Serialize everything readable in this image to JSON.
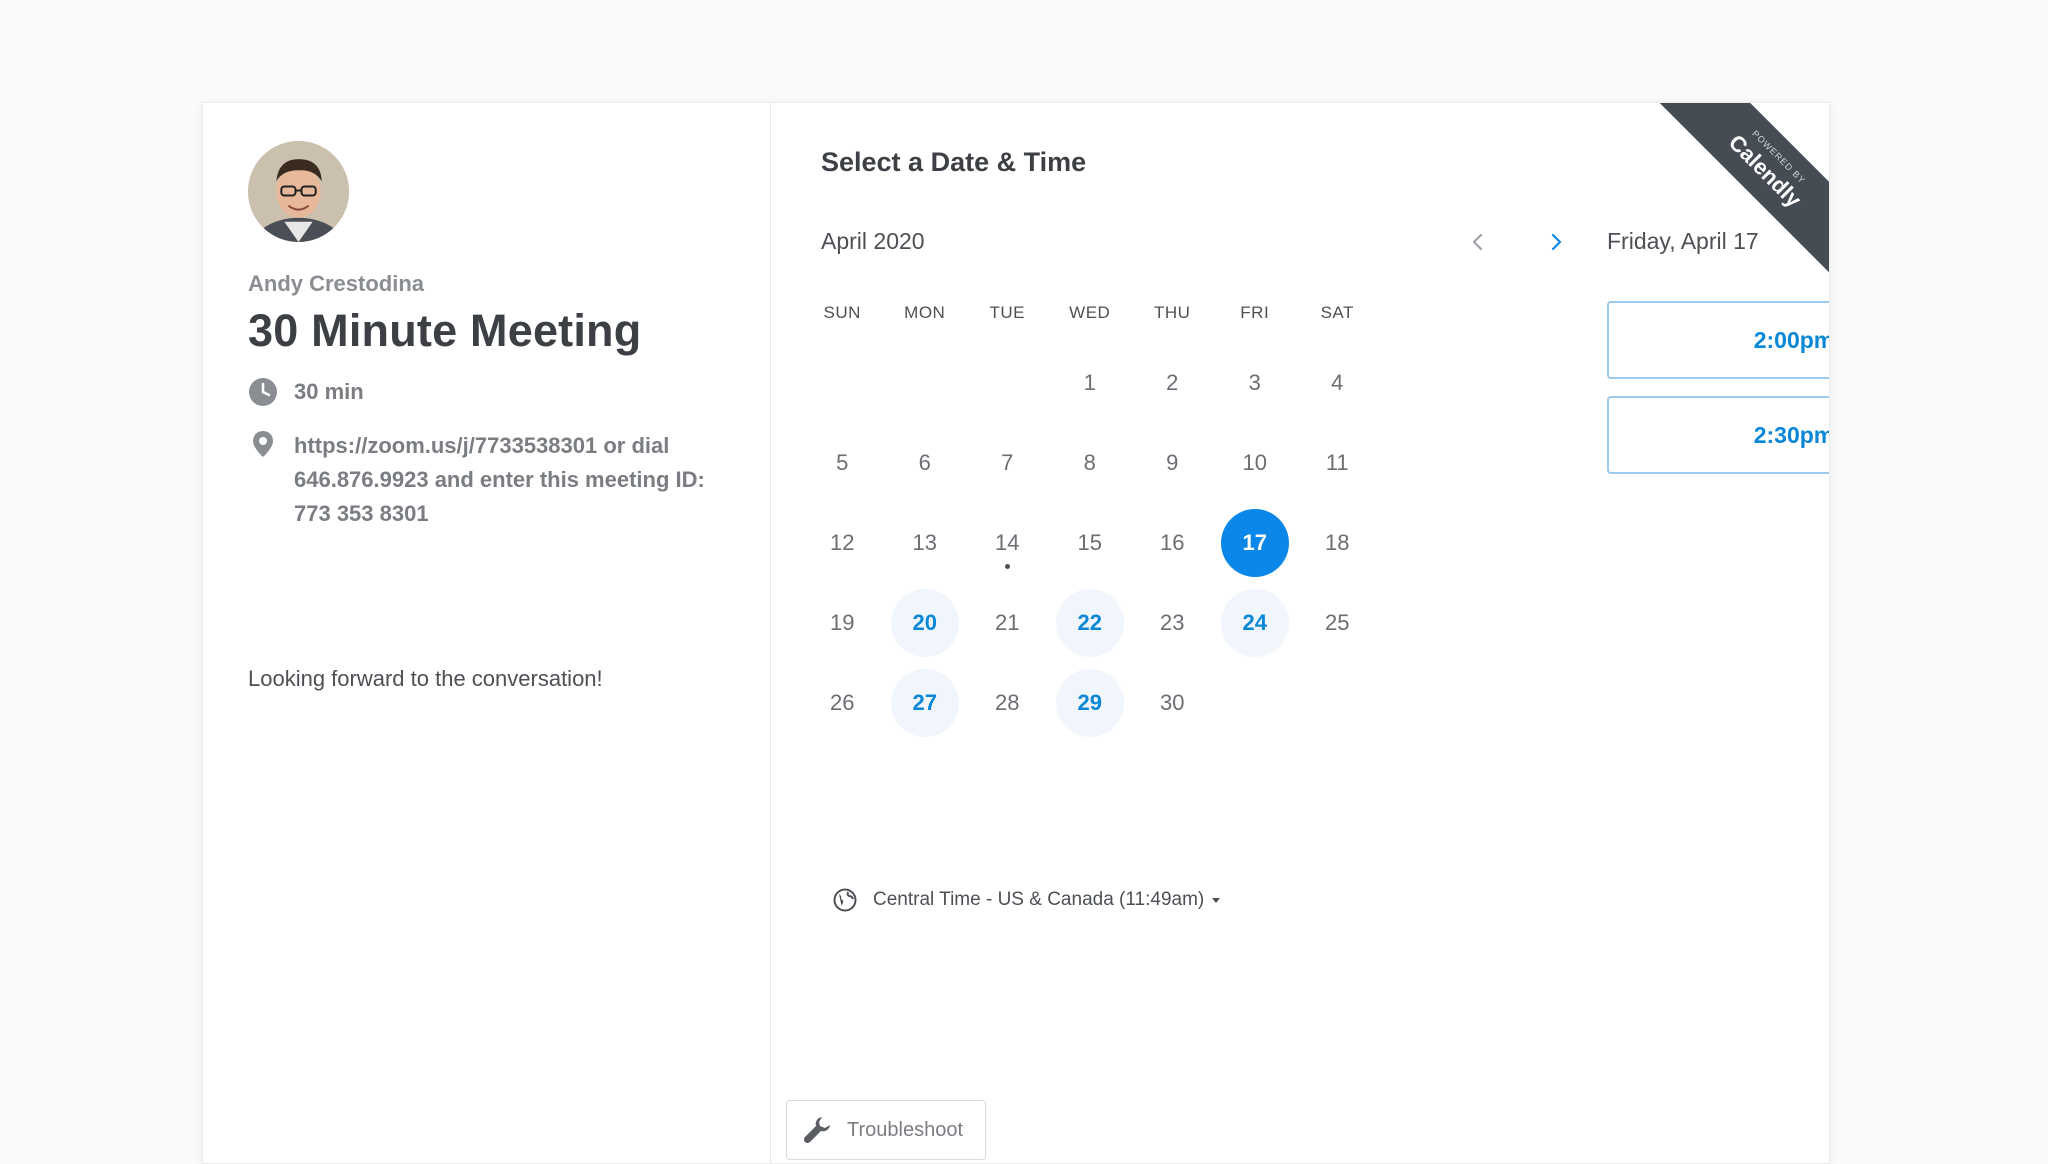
{
  "host": {
    "name": "Andy Crestodina"
  },
  "event": {
    "title": "30 Minute Meeting",
    "duration": "30 min",
    "location": "https://zoom.us/j/7733538301 or dial 646.876.9923 and enter this meeting ID: 773 353 8301",
    "description": "Looking forward to the conversation!"
  },
  "picker": {
    "title": "Select a Date & Time",
    "month": "April 2020",
    "weekdays": [
      "SUN",
      "MON",
      "TUE",
      "WED",
      "THU",
      "FRI",
      "SAT"
    ],
    "leading_blanks": 3,
    "days": [
      "1",
      "2",
      "3",
      "4",
      "5",
      "6",
      "7",
      "8",
      "9",
      "10",
      "11",
      "12",
      "13",
      "14",
      "15",
      "16",
      "17",
      "18",
      "19",
      "20",
      "21",
      "22",
      "23",
      "24",
      "25",
      "26",
      "27",
      "28",
      "29",
      "30"
    ],
    "available_days": [
      "17",
      "20",
      "22",
      "24",
      "27",
      "29"
    ],
    "selected_day": "17",
    "today": "14",
    "timezone": "Central Time - US & Canada (11:49am)"
  },
  "times": {
    "date_heading": "Friday, April 17",
    "slots": [
      "2:00pm",
      "2:30pm"
    ]
  },
  "badge": {
    "small": "POWERED BY",
    "brand": "Calendly"
  },
  "troubleshoot": {
    "label": "Troubleshoot"
  },
  "colors": {
    "accent": "#0a87e8",
    "available_bg": "#f1f6fc",
    "badge_bg": "#464c54"
  },
  "icons": {
    "duration": "clock-icon",
    "location": "location-pin-icon",
    "timezone": "globe-icon",
    "prev": "chevron-left-icon",
    "next": "chevron-right-icon",
    "troubleshoot": "wrench-icon"
  }
}
